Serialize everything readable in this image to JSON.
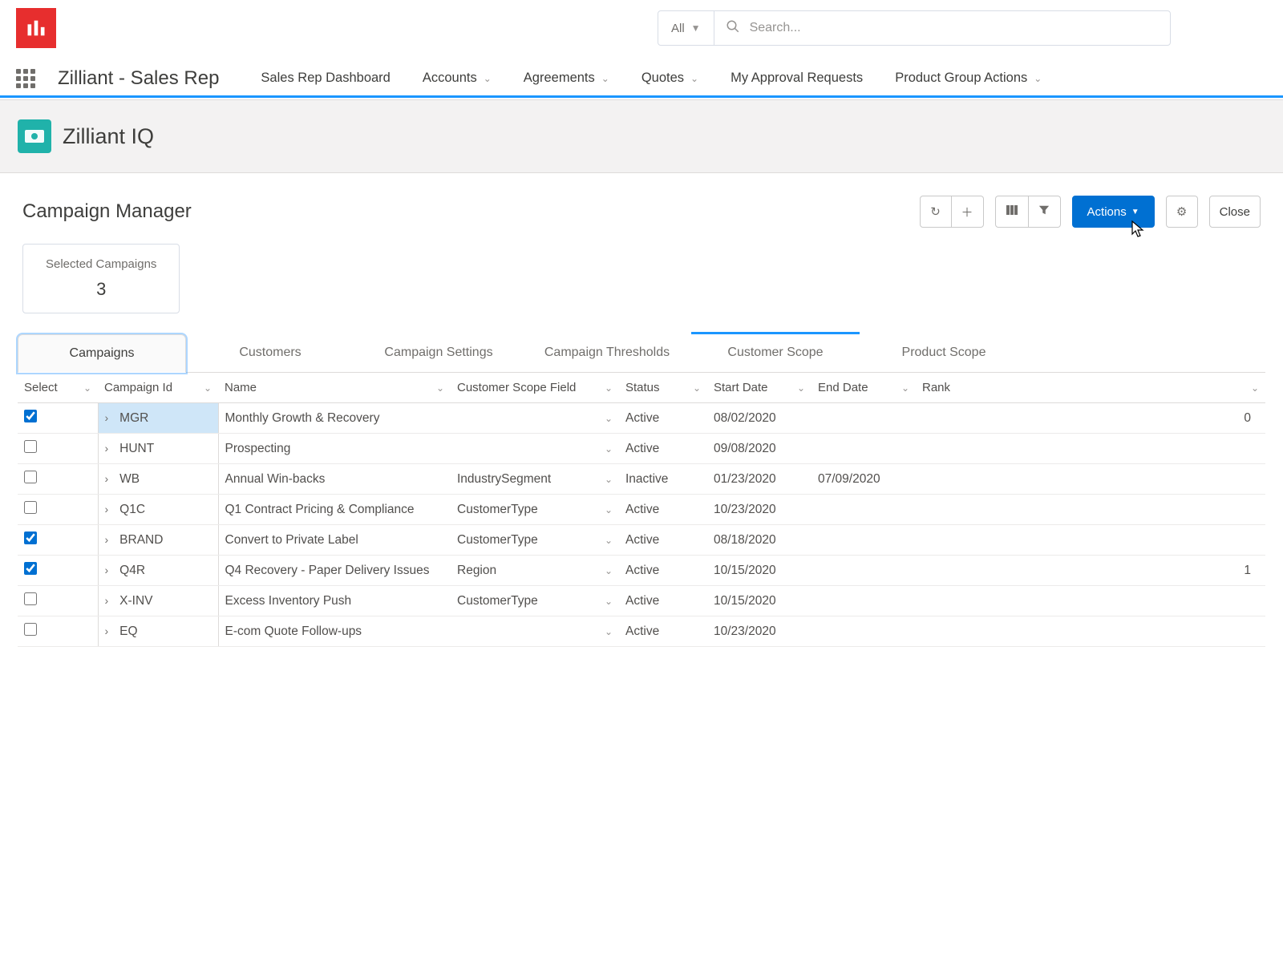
{
  "search": {
    "scope": "All",
    "placeholder": "Search..."
  },
  "appTitle": "Zilliant - Sales Rep",
  "nav": {
    "items": [
      {
        "label": "Sales Rep Dashboard",
        "hasMenu": false
      },
      {
        "label": "Accounts",
        "hasMenu": true
      },
      {
        "label": "Agreements",
        "hasMenu": true
      },
      {
        "label": "Quotes",
        "hasMenu": true
      },
      {
        "label": "My Approval Requests",
        "hasMenu": false
      },
      {
        "label": "Product Group Actions",
        "hasMenu": true
      }
    ]
  },
  "pageHeader": {
    "title": "Zilliant IQ"
  },
  "section": {
    "title": "Campaign Manager"
  },
  "toolbar": {
    "actions": "Actions",
    "close": "Close"
  },
  "summary": {
    "label": "Selected Campaigns",
    "value": "3"
  },
  "tabs": [
    {
      "label": "Campaigns",
      "active": true
    },
    {
      "label": "Customers"
    },
    {
      "label": "Campaign Settings"
    },
    {
      "label": "Campaign Thresholds"
    },
    {
      "label": "Customer Scope",
      "hinted": true
    },
    {
      "label": "Product Scope"
    }
  ],
  "columns": [
    "Select",
    "Campaign Id",
    "Name",
    "Customer Scope Field",
    "Status",
    "Start Date",
    "End Date",
    "Rank"
  ],
  "rows": [
    {
      "selected": true,
      "id": "MGR",
      "name": "Monthly Growth & Recovery",
      "scope": "",
      "status": "Active",
      "start": "08/02/2020",
      "end": "",
      "rank": "0",
      "hl": true
    },
    {
      "selected": false,
      "id": "HUNT",
      "name": "Prospecting",
      "scope": "",
      "status": "Active",
      "start": "09/08/2020",
      "end": "",
      "rank": ""
    },
    {
      "selected": false,
      "id": "WB",
      "name": "Annual Win-backs",
      "scope": "IndustrySegment",
      "status": "Inactive",
      "start": "01/23/2020",
      "end": "07/09/2020",
      "rank": ""
    },
    {
      "selected": false,
      "id": "Q1C",
      "name": "Q1 Contract Pricing & Compliance",
      "scope": "CustomerType",
      "status": "Active",
      "start": "10/23/2020",
      "end": "",
      "rank": ""
    },
    {
      "selected": true,
      "id": "BRAND",
      "name": "Convert to Private Label",
      "scope": "CustomerType",
      "status": "Active",
      "start": "08/18/2020",
      "end": "",
      "rank": ""
    },
    {
      "selected": true,
      "id": "Q4R",
      "name": "Q4 Recovery - Paper Delivery Issues",
      "scope": "Region",
      "status": "Active",
      "start": "10/15/2020",
      "end": "",
      "rank": "1"
    },
    {
      "selected": false,
      "id": "X-INV",
      "name": "Excess Inventory Push",
      "scope": "CustomerType",
      "status": "Active",
      "start": "10/15/2020",
      "end": "",
      "rank": ""
    },
    {
      "selected": false,
      "id": "EQ",
      "name": "E-com Quote Follow-ups",
      "scope": "",
      "status": "Active",
      "start": "10/23/2020",
      "end": "",
      "rank": ""
    }
  ]
}
